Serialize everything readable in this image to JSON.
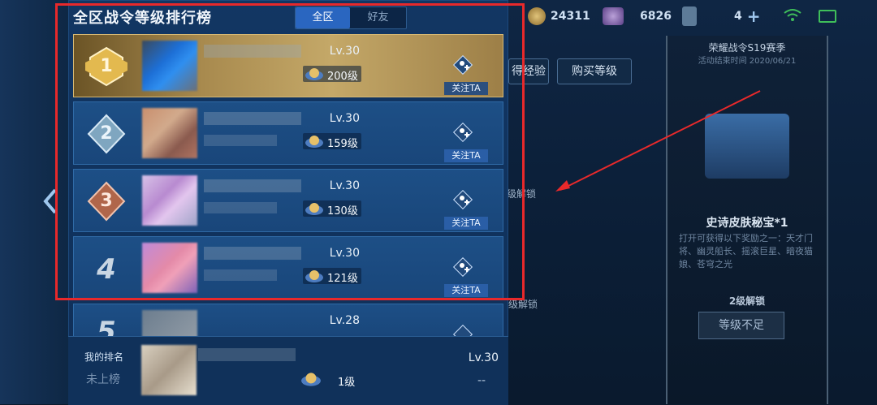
{
  "panel": {
    "title": "全区战令等级排行榜",
    "tabs": [
      {
        "label": "全区",
        "active": true
      },
      {
        "label": "好友",
        "active": false
      }
    ]
  },
  "top_bar": {
    "coins": "24311",
    "gems": "6826",
    "cards": "4"
  },
  "ranking": [
    {
      "rank": "1",
      "lv": "Lv.30",
      "level": "200级",
      "follow": "关注TA"
    },
    {
      "rank": "2",
      "lv": "Lv.30",
      "level": "159级",
      "follow": "关注TA"
    },
    {
      "rank": "3",
      "lv": "Lv.30",
      "level": "130级",
      "follow": "关注TA"
    },
    {
      "rank": "4",
      "lv": "Lv.30",
      "level": "121级",
      "follow": "关注TA"
    },
    {
      "rank": "5",
      "lv": "Lv.28",
      "level": "",
      "follow": ""
    }
  ],
  "my_rank": {
    "label": "我的排名",
    "value": "未上榜",
    "lv": "Lv.30",
    "level": "1级",
    "dash": "--"
  },
  "right_panel": {
    "season": "荣耀战令S19赛季",
    "season_end": "活动结束时间 2020/06/21",
    "buy_level": "购买等级",
    "exp_button": "得经验",
    "reward_name": "史诗皮肤秘宝*1",
    "reward_desc": "打开可获得以下奖励之一：天才门将、幽灵船长、摇滚巨星、暗夜猫娘、苍穹之光",
    "unlock": "2级解锁",
    "not_enough": "等级不足",
    "mid_text1": "级解锁",
    "mid_text2": "级解锁"
  },
  "colors": {
    "highlight": "#e8292b",
    "panel": "#123663",
    "gold": "#c4a868",
    "tab_active": "#2a66c0"
  }
}
